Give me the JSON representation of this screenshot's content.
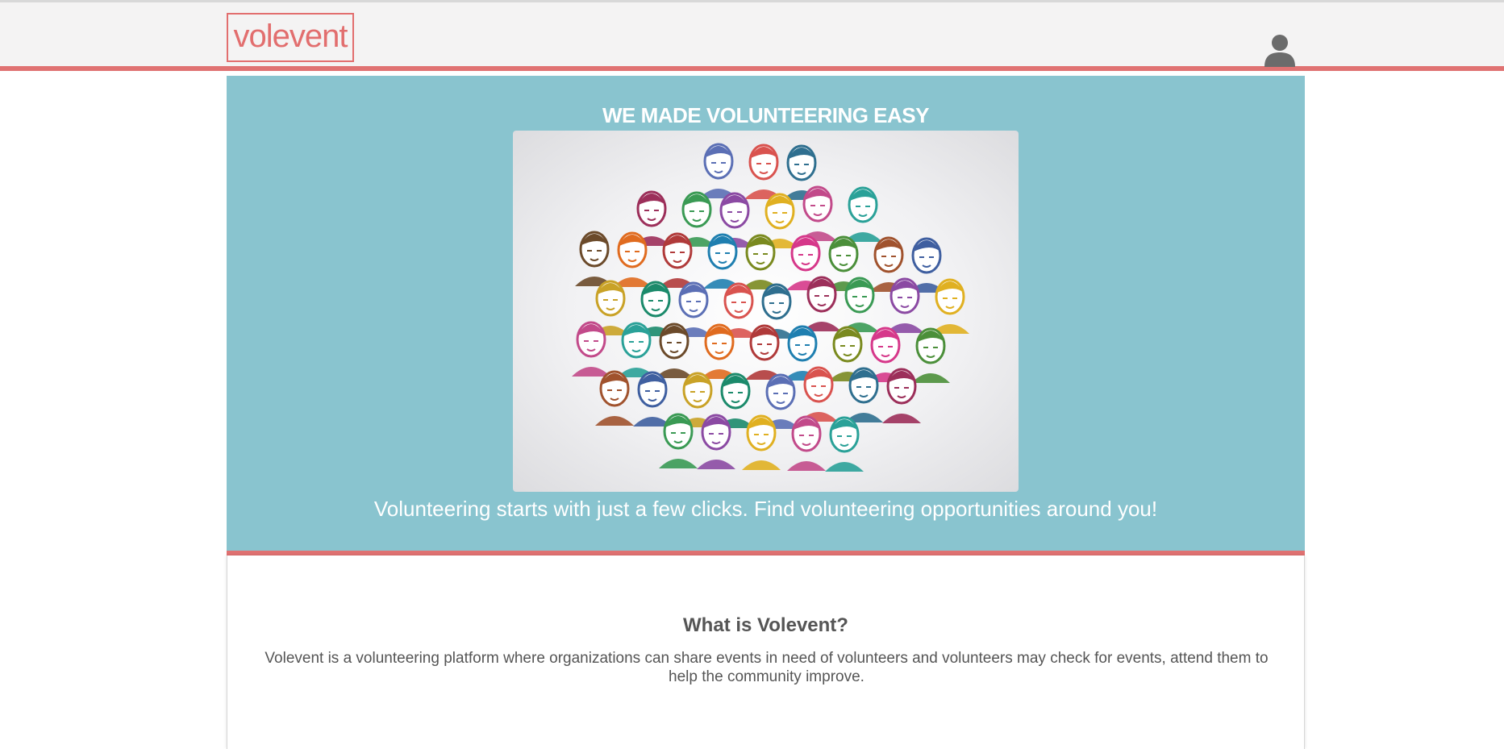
{
  "header": {
    "logo_text": "volevent",
    "user_icon": "user-icon",
    "accent_color": "#e07272"
  },
  "hero": {
    "title": "WE MADE VOLUNTEERING EASY",
    "image_icon": "illustration-crowd-of-diverse-people",
    "subtitle": "Volunteering starts with just a few clicks. Find volunteering opportunities around you!",
    "background_color": "#89c4cf"
  },
  "about": {
    "title": "What is Volevent?",
    "description": "Volevent is a volunteering platform where organizations can share events in need of volunteers and volunteers may check for events, attend them to help the community improve."
  }
}
